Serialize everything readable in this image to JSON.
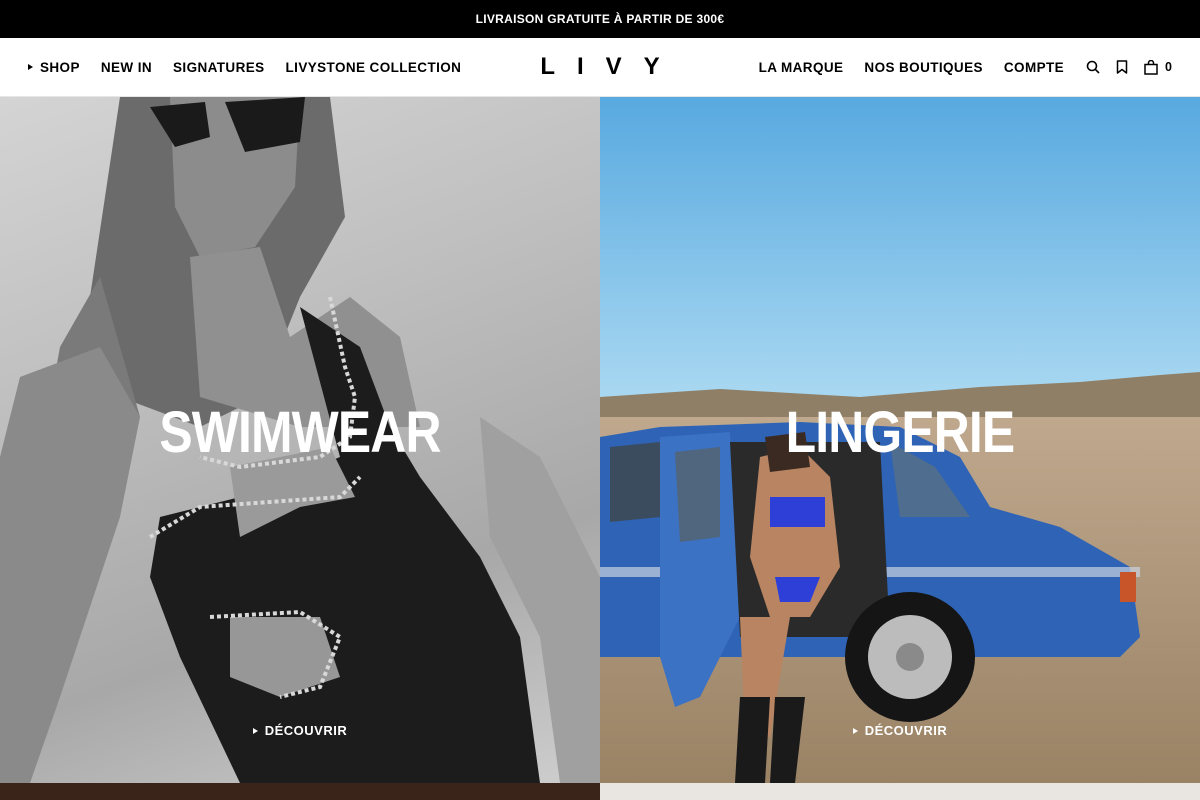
{
  "announcement": "LIVRAISON GRATUITE À PARTIR DE 300€",
  "header": {
    "nav_left": [
      "SHOP",
      "NEW IN",
      "SIGNATURES",
      "LIVYSTONE COLLECTION"
    ],
    "logo": "LIVY",
    "nav_right": [
      "LA MARQUE",
      "NOS BOUTIQUES",
      "COMPTE"
    ],
    "icons": [
      "search-icon",
      "bookmark-icon",
      "shopping-bag-icon"
    ],
    "cart_count": "0"
  },
  "panels": [
    {
      "title": "SWIMWEAR",
      "cta": "DÉCOUVRIR"
    },
    {
      "title": "LINGERIE",
      "cta": "DÉCOUVRIR"
    }
  ],
  "colors": {
    "announcement_bg": "#000000",
    "text": "#000000",
    "header_bg": "#ffffff",
    "car_blue": "#2f63b8",
    "sky_blue": "#6fb7e6"
  }
}
